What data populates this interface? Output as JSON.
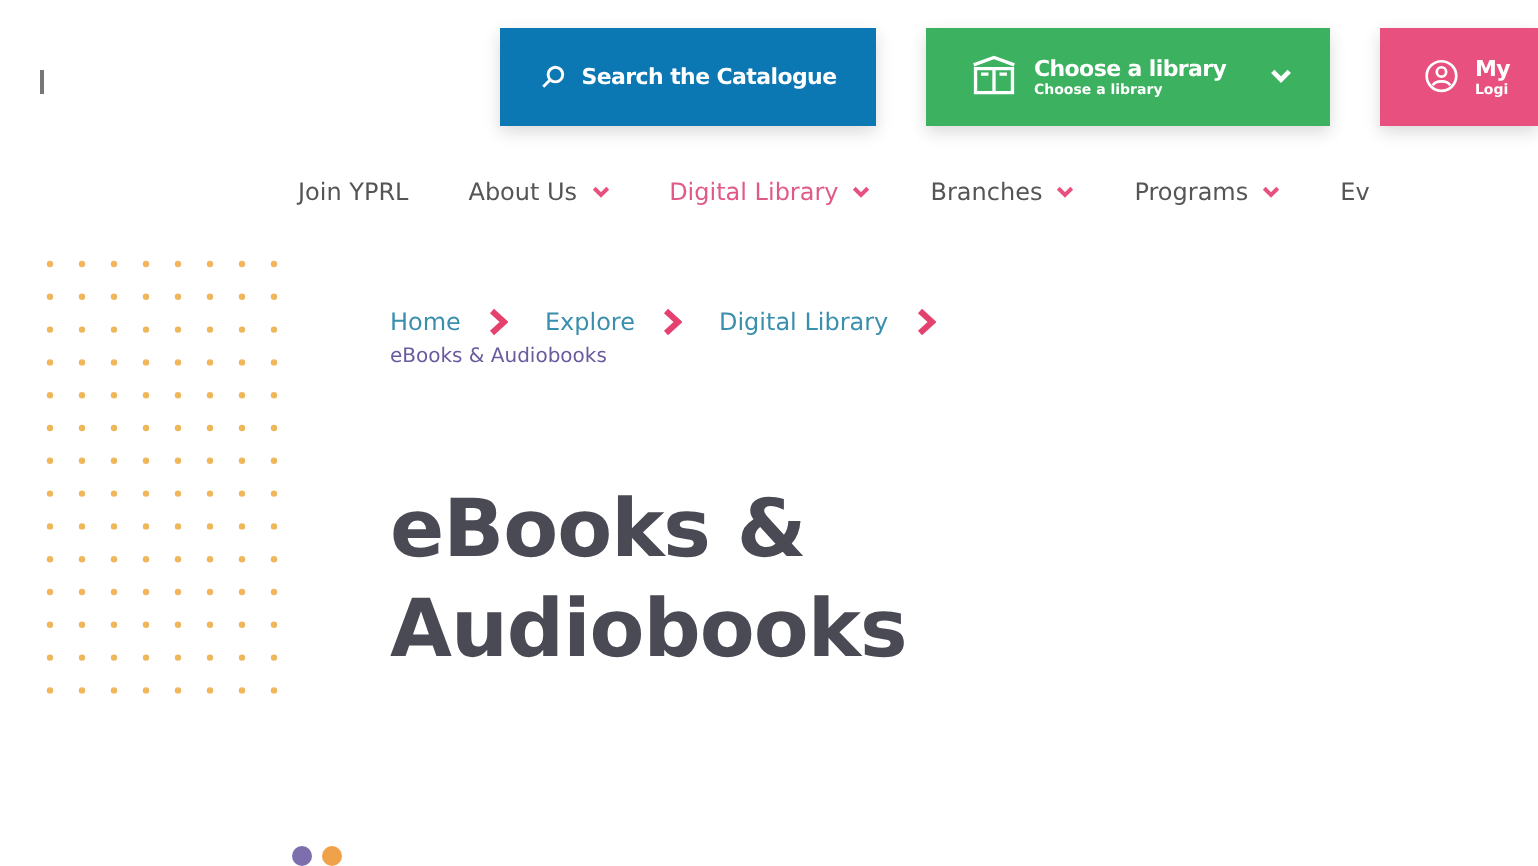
{
  "header_buttons": [
    {
      "kind": "search",
      "label": "Search the Catalogue"
    },
    {
      "kind": "library",
      "label": "Choose a library",
      "sublabel": "Choose a library"
    },
    {
      "kind": "account",
      "label": "My",
      "sublabel": "Logi"
    }
  ],
  "nav": [
    {
      "label": "Join YPRL",
      "dropdown": false,
      "selected": false
    },
    {
      "label": "About Us",
      "dropdown": true,
      "selected": false
    },
    {
      "label": "Digital Library",
      "dropdown": true,
      "selected": true
    },
    {
      "label": "Branches",
      "dropdown": true,
      "selected": false
    },
    {
      "label": "Programs",
      "dropdown": true,
      "selected": false
    },
    {
      "label": "Ev",
      "dropdown": false,
      "selected": false
    }
  ],
  "breadcrumb": [
    "Home",
    "Explore",
    "Digital Library"
  ],
  "breadcrumb_current": "eBooks & Audiobooks",
  "title": "eBooks & Audiobooks"
}
